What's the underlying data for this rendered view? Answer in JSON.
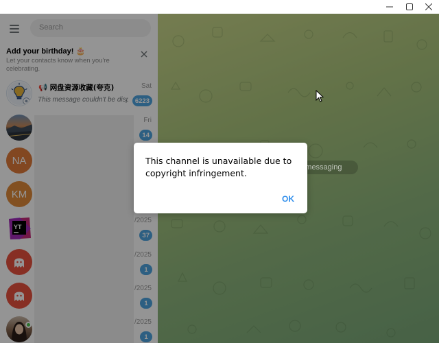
{
  "window": {
    "minimize_icon": "minimize-icon",
    "maximize_icon": "maximize-icon",
    "close_icon": "close-icon"
  },
  "sidebar": {
    "search_placeholder": "Search",
    "birthday_banner": {
      "title": "Add your birthday! 🎂",
      "subtitle": "Let your contacts know when you're celebrating."
    },
    "chats": [
      {
        "name": "📢 网盘资源收藏(夸克)",
        "preview": "This message couldn't be displayed",
        "time": "Sat",
        "badge": "6223"
      },
      {
        "time": "Fri",
        "badge": "14"
      },
      {
        "initials": "NA",
        "avatar_color": "#e07a3a"
      },
      {
        "initials": "KM",
        "avatar_color": "#e08a3a"
      },
      {
        "time": "/2025",
        "badge": "37"
      },
      {
        "time": "/2025",
        "badge": "1"
      },
      {
        "time": "/2025",
        "badge": "1"
      },
      {
        "time": "/2025",
        "badge": "1"
      }
    ]
  },
  "chat": {
    "start_messaging": "rt messaging"
  },
  "dialog": {
    "message": "This channel is unavailable due to copyright infringement.",
    "ok_label": "OK"
  },
  "colors": {
    "accent": "#3390ec",
    "badge": "#4ea4e0",
    "ghost_avatar": "#e8513f"
  }
}
